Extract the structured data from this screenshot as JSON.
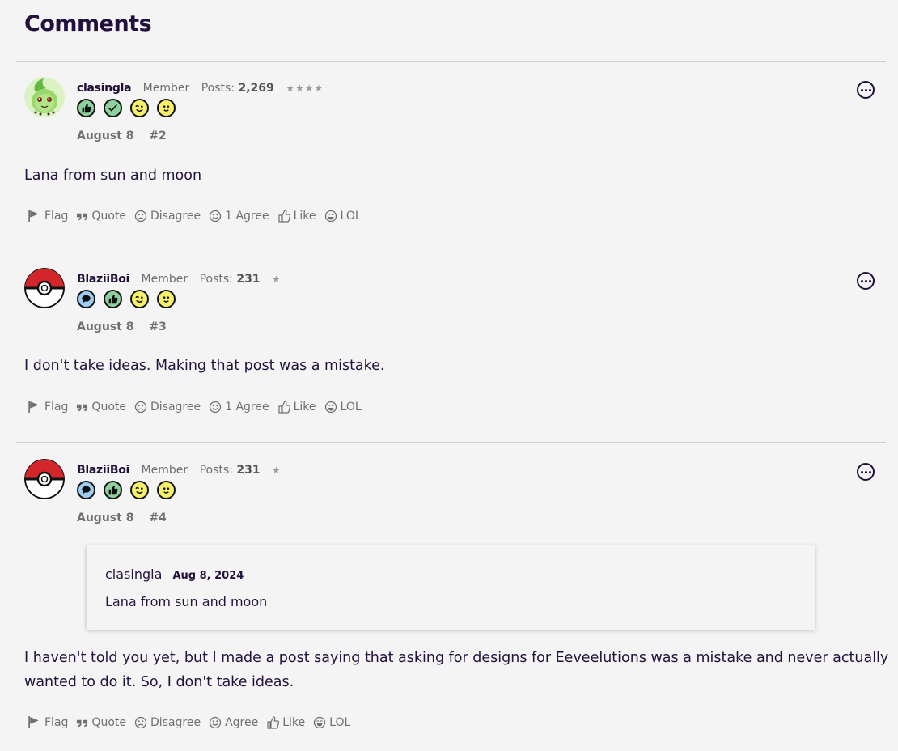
{
  "page": {
    "title": "Comments"
  },
  "colors": {
    "accent": "#22103f",
    "muted": "#6f6f6f",
    "badge_green": "#8fd19e",
    "badge_yellow": "#f6f06b",
    "badge_blue": "#9fcdf2",
    "pokeball_red": "#d3262b"
  },
  "posts": [
    {
      "username": "clasingla",
      "role": "Member",
      "posts_label": "Posts:",
      "posts_count": "2,269",
      "stars": "★★★★",
      "avatar": "chikorita-avatar",
      "badges": [
        "thumbs-up-badge",
        "check-badge",
        "wink-badge",
        "smile-badge"
      ],
      "date": "August 8",
      "number": "#2",
      "text": "Lana from sun and moon",
      "actions": {
        "flag": "Flag",
        "quote": "Quote",
        "disagree": "Disagree",
        "agree": "1 Agree",
        "like": "Like",
        "lol": "LOL"
      }
    },
    {
      "username": "BlaziiBoi",
      "role": "Member",
      "posts_label": "Posts:",
      "posts_count": "231",
      "stars": "★",
      "avatar": "pokeball-avatar",
      "badges": [
        "speech-badge",
        "thumbs-up-badge",
        "wink-badge",
        "smile-badge"
      ],
      "date": "August 8",
      "number": "#3",
      "text": "I don't take ideas. Making that post was a mistake.",
      "actions": {
        "flag": "Flag",
        "quote": "Quote",
        "disagree": "Disagree",
        "agree": "1 Agree",
        "like": "Like",
        "lol": "LOL"
      }
    },
    {
      "username": "BlaziiBoi",
      "role": "Member",
      "posts_label": "Posts:",
      "posts_count": "231",
      "stars": "★",
      "avatar": "pokeball-avatar",
      "badges": [
        "speech-badge",
        "thumbs-up-badge",
        "wink-badge",
        "smile-badge"
      ],
      "date": "August 8",
      "number": "#4",
      "quote": {
        "author": "clasingla",
        "date": "Aug 8, 2024",
        "text": "Lana from sun and moon"
      },
      "text_line1": "I haven't told you yet, but I made a post saying that asking for designs for Eeveelutions was a mistake and never actually",
      "text_line2": "wanted to do it. So, I don't take ideas.",
      "actions": {
        "flag": "Flag",
        "quote": "Quote",
        "disagree": "Disagree",
        "agree": "Agree",
        "like": "Like",
        "lol": "LOL"
      }
    }
  ]
}
